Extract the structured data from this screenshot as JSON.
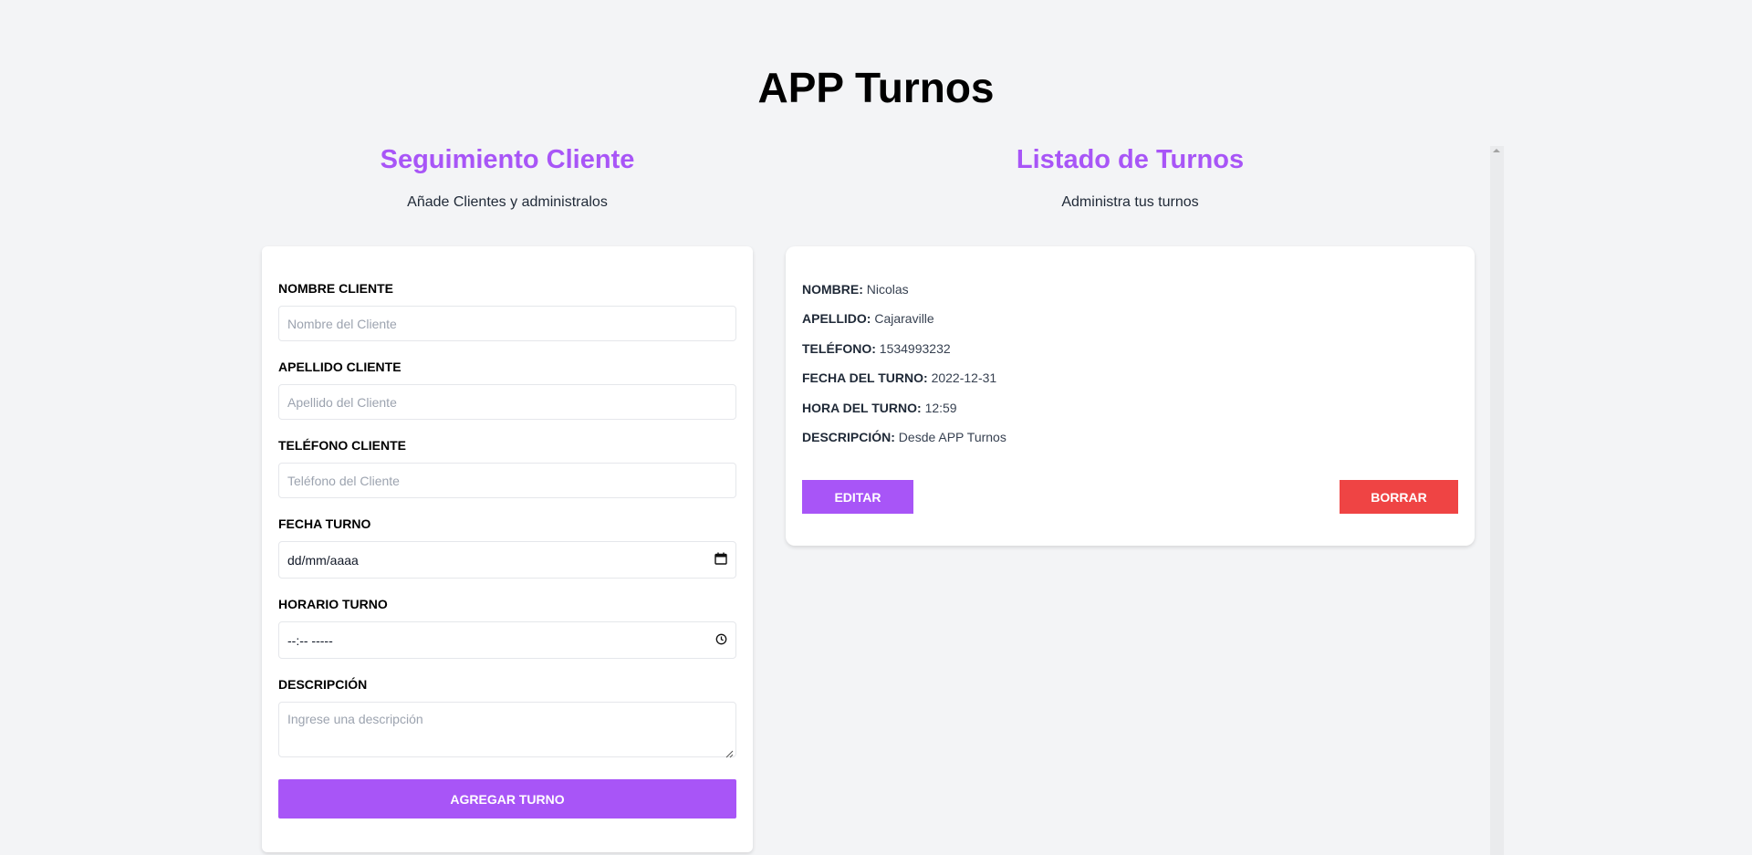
{
  "app": {
    "title": "APP Turnos"
  },
  "form_section": {
    "title": "Seguimiento Cliente",
    "subtitle": "Añade Clientes y administralos",
    "fields": {
      "nombre": {
        "label": "NOMBRE CLIENTE",
        "placeholder": "Nombre del Cliente"
      },
      "apellido": {
        "label": "APELLIDO CLIENTE",
        "placeholder": "Apellido del Cliente"
      },
      "telefono": {
        "label": "TELÉFONO CLIENTE",
        "placeholder": "Teléfono del Cliente"
      },
      "fecha": {
        "label": "FECHA TURNO",
        "value": "dd/mm/aaaa"
      },
      "horario": {
        "label": "HORARIO TURNO",
        "value": "--:-- -----"
      },
      "descripcion": {
        "label": "DESCRIPCIÓN",
        "placeholder": "Ingrese una descripción"
      }
    },
    "submit_label": "AGREGAR TURNO"
  },
  "list_section": {
    "title": "Listado de Turnos",
    "subtitle": "Administra tus turnos",
    "turno": {
      "nombre_key": "NOMBRE:",
      "nombre": "Nicolas",
      "apellido_key": "APELLIDO:",
      "apellido": "Cajaraville",
      "telefono_key": "TELÉFONO:",
      "telefono": "1534993232",
      "fecha_key": "FECHA DEL TURNO:",
      "fecha": "2022-12-31",
      "hora_key": "HORA DEL TURNO:",
      "hora": "12:59",
      "descripcion_key": "DESCRIPCIÓN:",
      "descripcion": "Desde APP Turnos"
    },
    "edit_label": "EDITAR",
    "delete_label": "BORRAR"
  },
  "icons": {
    "date": "calendar-icon",
    "time": "clock-icon",
    "resize": "resize-handle-icon"
  },
  "colors": {
    "accent": "#a855f7",
    "danger": "#ef4444",
    "background": "#f3f4f6"
  }
}
